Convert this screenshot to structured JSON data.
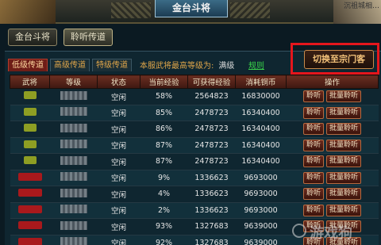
{
  "window": {
    "title": "金台斗将"
  },
  "corner": {
    "text": "沉祖城相…"
  },
  "top_tabs": [
    {
      "label": "金台斗将",
      "active": false
    },
    {
      "label": "聆听传道",
      "active": true
    }
  ],
  "sub_tabs": [
    {
      "label": "低级传道",
      "active": true
    },
    {
      "label": "高级传道",
      "active": false
    },
    {
      "label": "特级传道",
      "active": false
    }
  ],
  "level_info": {
    "label": "本服武将最高等级为:",
    "value": "满级"
  },
  "rules_link": "规则",
  "switch_button": "切换至宗门客",
  "table": {
    "headers": [
      "武将",
      "等级",
      "状态",
      "当前经验",
      "可获得经验",
      "消耗铜币",
      "操作"
    ],
    "rows": [
      {
        "general_color": "green",
        "status": "空闲",
        "current_exp": "58%",
        "gain_exp": "2564823",
        "cost": "16830000"
      },
      {
        "general_color": "green",
        "status": "空闲",
        "current_exp": "85%",
        "gain_exp": "2478723",
        "cost": "16340400"
      },
      {
        "general_color": "green",
        "status": "空闲",
        "current_exp": "86%",
        "gain_exp": "2478723",
        "cost": "16340400"
      },
      {
        "general_color": "green",
        "status": "空闲",
        "current_exp": "87%",
        "gain_exp": "2478723",
        "cost": "16340400"
      },
      {
        "general_color": "green",
        "status": "空闲",
        "current_exp": "87%",
        "gain_exp": "2478723",
        "cost": "16340400"
      },
      {
        "general_color": "red",
        "status": "空闲",
        "current_exp": "9%",
        "gain_exp": "1336623",
        "cost": "9693000"
      },
      {
        "general_color": "red",
        "status": "空闲",
        "current_exp": "4%",
        "gain_exp": "1336623",
        "cost": "9693000"
      },
      {
        "general_color": "red",
        "status": "空闲",
        "current_exp": "2%",
        "gain_exp": "1336623",
        "cost": "9693000"
      },
      {
        "general_color": "red",
        "status": "空闲",
        "current_exp": "93%",
        "gain_exp": "1327683",
        "cost": "9639000"
      },
      {
        "general_color": "red",
        "status": "空闲",
        "current_exp": "92%",
        "gain_exp": "1327683",
        "cost": "9639000"
      }
    ],
    "actions": {
      "listen": "聆听",
      "batch_listen": "批量聆听"
    }
  },
  "watermark": "游戏狗",
  "colors": {
    "highlight": "#e5161c",
    "header_bg": "#6b2e21",
    "link": "#39d34a",
    "label": "#e0a64a"
  }
}
